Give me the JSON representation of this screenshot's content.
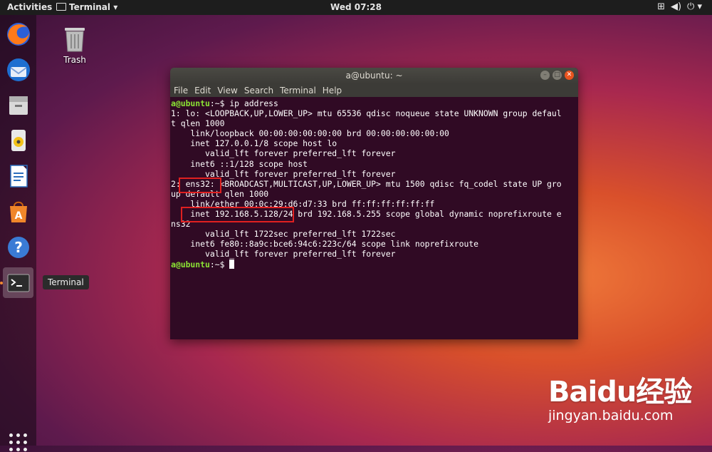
{
  "topbar": {
    "activities": "Activities",
    "app_menu": "Terminal",
    "clock": "Wed 07:28",
    "network_icon": "network-icon",
    "volume_icon": "volume-icon",
    "power_icon": "power-icon"
  },
  "dock": {
    "items": [
      {
        "name": "firefox",
        "icon": "firefox-icon"
      },
      {
        "name": "thunderbird",
        "icon": "thunderbird-icon"
      },
      {
        "name": "files",
        "icon": "files-icon"
      },
      {
        "name": "rhythmbox",
        "icon": "rhythmbox-icon"
      },
      {
        "name": "libreoffice-writer",
        "icon": "writer-icon"
      },
      {
        "name": "ubuntu-software",
        "icon": "software-icon"
      },
      {
        "name": "help",
        "icon": "help-icon"
      },
      {
        "name": "terminal",
        "icon": "terminal-icon"
      }
    ],
    "tooltip": "Terminal"
  },
  "desktop": {
    "trash_label": "Trash"
  },
  "terminal": {
    "title": "a@ubuntu: ~",
    "menu": [
      "File",
      "Edit",
      "View",
      "Search",
      "Terminal",
      "Help"
    ],
    "prompt": "a@ubuntu",
    "prompt_suffix": ":~$ ",
    "command": "ip address",
    "output": [
      "1: lo: <LOOPBACK,UP,LOWER_UP> mtu 65536 qdisc noqueue state UNKNOWN group defaul",
      "t qlen 1000",
      "    link/loopback 00:00:00:00:00:00 brd 00:00:00:00:00:00",
      "    inet 127.0.0.1/8 scope host lo",
      "       valid_lft forever preferred_lft forever",
      "    inet6 ::1/128 scope host",
      "       valid_lft forever preferred_lft forever",
      "2: ens32: <BROADCAST,MULTICAST,UP,LOWER_UP> mtu 1500 qdisc fq_codel state UP gro",
      "up default qlen 1000",
      "    link/ether 00:0c:29:d6:d7:33 brd ff:ff:ff:ff:ff:ff",
      "    inet 192.168.5.128/24 brd 192.168.5.255 scope global dynamic noprefixroute e",
      "ns32",
      "       valid_lft 1722sec preferred_lft 1722sec",
      "    inet6 fe80::8a9c:bce6:94c6:223c/64 scope link noprefixroute",
      "       valid_lft forever preferred_lft forever"
    ]
  },
  "watermark": {
    "logo": "Baidu经验",
    "url": "jingyan.baidu.com"
  },
  "colors": {
    "highlight": "#e02020",
    "prompt": "#8ae234",
    "terminal_bg": "#300a24"
  }
}
